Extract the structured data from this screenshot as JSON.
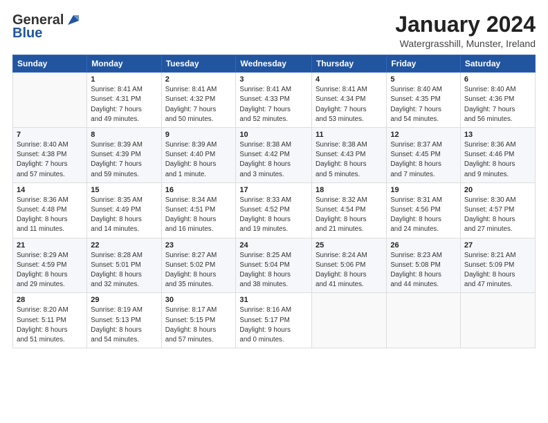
{
  "logo": {
    "general": "General",
    "blue": "Blue"
  },
  "header": {
    "month_title": "January 2024",
    "location": "Watergrasshill, Munster, Ireland"
  },
  "days_of_week": [
    "Sunday",
    "Monday",
    "Tuesday",
    "Wednesday",
    "Thursday",
    "Friday",
    "Saturday"
  ],
  "weeks": [
    [
      {
        "day": "",
        "info": ""
      },
      {
        "day": "1",
        "info": "Sunrise: 8:41 AM\nSunset: 4:31 PM\nDaylight: 7 hours\nand 49 minutes."
      },
      {
        "day": "2",
        "info": "Sunrise: 8:41 AM\nSunset: 4:32 PM\nDaylight: 7 hours\nand 50 minutes."
      },
      {
        "day": "3",
        "info": "Sunrise: 8:41 AM\nSunset: 4:33 PM\nDaylight: 7 hours\nand 52 minutes."
      },
      {
        "day": "4",
        "info": "Sunrise: 8:41 AM\nSunset: 4:34 PM\nDaylight: 7 hours\nand 53 minutes."
      },
      {
        "day": "5",
        "info": "Sunrise: 8:40 AM\nSunset: 4:35 PM\nDaylight: 7 hours\nand 54 minutes."
      },
      {
        "day": "6",
        "info": "Sunrise: 8:40 AM\nSunset: 4:36 PM\nDaylight: 7 hours\nand 56 minutes."
      }
    ],
    [
      {
        "day": "7",
        "info": "Sunrise: 8:40 AM\nSunset: 4:38 PM\nDaylight: 7 hours\nand 57 minutes."
      },
      {
        "day": "8",
        "info": "Sunrise: 8:39 AM\nSunset: 4:39 PM\nDaylight: 7 hours\nand 59 minutes."
      },
      {
        "day": "9",
        "info": "Sunrise: 8:39 AM\nSunset: 4:40 PM\nDaylight: 8 hours\nand 1 minute."
      },
      {
        "day": "10",
        "info": "Sunrise: 8:38 AM\nSunset: 4:42 PM\nDaylight: 8 hours\nand 3 minutes."
      },
      {
        "day": "11",
        "info": "Sunrise: 8:38 AM\nSunset: 4:43 PM\nDaylight: 8 hours\nand 5 minutes."
      },
      {
        "day": "12",
        "info": "Sunrise: 8:37 AM\nSunset: 4:45 PM\nDaylight: 8 hours\nand 7 minutes."
      },
      {
        "day": "13",
        "info": "Sunrise: 8:36 AM\nSunset: 4:46 PM\nDaylight: 8 hours\nand 9 minutes."
      }
    ],
    [
      {
        "day": "14",
        "info": "Sunrise: 8:36 AM\nSunset: 4:48 PM\nDaylight: 8 hours\nand 11 minutes."
      },
      {
        "day": "15",
        "info": "Sunrise: 8:35 AM\nSunset: 4:49 PM\nDaylight: 8 hours\nand 14 minutes."
      },
      {
        "day": "16",
        "info": "Sunrise: 8:34 AM\nSunset: 4:51 PM\nDaylight: 8 hours\nand 16 minutes."
      },
      {
        "day": "17",
        "info": "Sunrise: 8:33 AM\nSunset: 4:52 PM\nDaylight: 8 hours\nand 19 minutes."
      },
      {
        "day": "18",
        "info": "Sunrise: 8:32 AM\nSunset: 4:54 PM\nDaylight: 8 hours\nand 21 minutes."
      },
      {
        "day": "19",
        "info": "Sunrise: 8:31 AM\nSunset: 4:56 PM\nDaylight: 8 hours\nand 24 minutes."
      },
      {
        "day": "20",
        "info": "Sunrise: 8:30 AM\nSunset: 4:57 PM\nDaylight: 8 hours\nand 27 minutes."
      }
    ],
    [
      {
        "day": "21",
        "info": "Sunrise: 8:29 AM\nSunset: 4:59 PM\nDaylight: 8 hours\nand 29 minutes."
      },
      {
        "day": "22",
        "info": "Sunrise: 8:28 AM\nSunset: 5:01 PM\nDaylight: 8 hours\nand 32 minutes."
      },
      {
        "day": "23",
        "info": "Sunrise: 8:27 AM\nSunset: 5:02 PM\nDaylight: 8 hours\nand 35 minutes."
      },
      {
        "day": "24",
        "info": "Sunrise: 8:25 AM\nSunset: 5:04 PM\nDaylight: 8 hours\nand 38 minutes."
      },
      {
        "day": "25",
        "info": "Sunrise: 8:24 AM\nSunset: 5:06 PM\nDaylight: 8 hours\nand 41 minutes."
      },
      {
        "day": "26",
        "info": "Sunrise: 8:23 AM\nSunset: 5:08 PM\nDaylight: 8 hours\nand 44 minutes."
      },
      {
        "day": "27",
        "info": "Sunrise: 8:21 AM\nSunset: 5:09 PM\nDaylight: 8 hours\nand 47 minutes."
      }
    ],
    [
      {
        "day": "28",
        "info": "Sunrise: 8:20 AM\nSunset: 5:11 PM\nDaylight: 8 hours\nand 51 minutes."
      },
      {
        "day": "29",
        "info": "Sunrise: 8:19 AM\nSunset: 5:13 PM\nDaylight: 8 hours\nand 54 minutes."
      },
      {
        "day": "30",
        "info": "Sunrise: 8:17 AM\nSunset: 5:15 PM\nDaylight: 8 hours\nand 57 minutes."
      },
      {
        "day": "31",
        "info": "Sunrise: 8:16 AM\nSunset: 5:17 PM\nDaylight: 9 hours\nand 0 minutes."
      },
      {
        "day": "",
        "info": ""
      },
      {
        "day": "",
        "info": ""
      },
      {
        "day": "",
        "info": ""
      }
    ]
  ]
}
